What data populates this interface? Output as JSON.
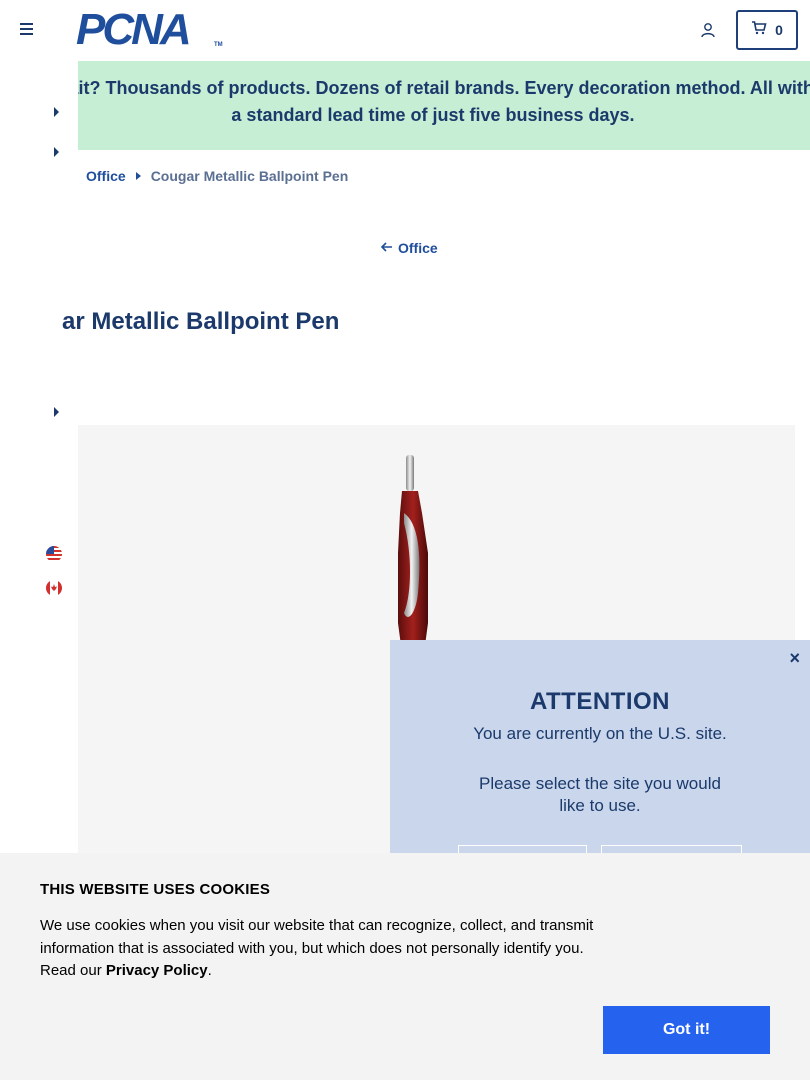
{
  "header": {
    "logo_text": "PCNA",
    "logo_tm": "TM",
    "cart_count": "0"
  },
  "banner": {
    "text": "Wait? Thousands of products. Dozens of retail brands. Every decoration method. All with a standard lead time of just five business days."
  },
  "breadcrumb": {
    "items": [
      "Office",
      "Cougar Metallic Ballpoint Pen"
    ]
  },
  "back_link": "Office",
  "product": {
    "title": "ar Metallic Ballpoint Pen"
  },
  "attention": {
    "close": "×",
    "title": "ATTENTION",
    "line1": "You are currently on the U.S. site.",
    "line2": "Please select the site you would like to use."
  },
  "cookie": {
    "title": "THIS WEBSITE USES COOKIES",
    "text_before": "We use cookies when you visit our website that can recognize, collect, and transmit information that is associated with you, but which does not personally identify you. Read our ",
    "link": "Privacy Policy",
    "text_after": ".",
    "button": "Got it!"
  },
  "colors": {
    "brand": "#1f4e9c",
    "banner_bg": "#c5eed4",
    "attention_bg": "#c9d6ec",
    "cookie_button": "#2563ee"
  },
  "icons": [
    "menu-icon",
    "account-icon",
    "cart-icon",
    "arrow-left-icon",
    "us-flag-icon",
    "canada-flag-icon",
    "close-icon"
  ]
}
